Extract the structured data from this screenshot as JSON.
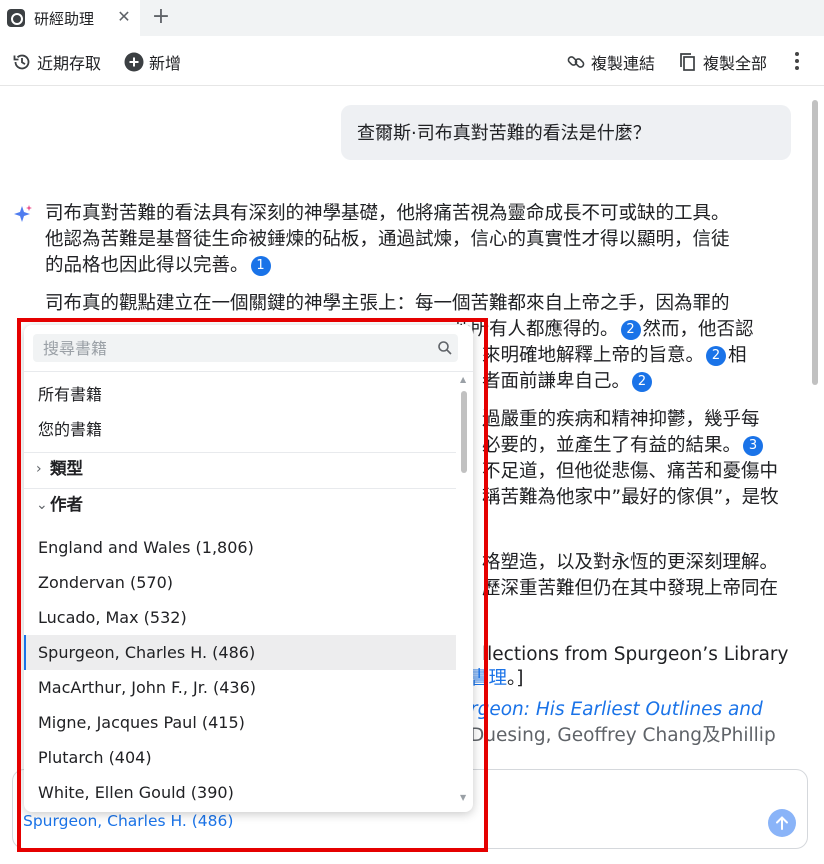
{
  "tab": {
    "title": "研經助理",
    "close_glyph": "✕",
    "new_glyph": "+"
  },
  "toolbar": {
    "recent": "近期存取",
    "new": "新增",
    "copy_link": "複製連結",
    "copy_all": "複製全部"
  },
  "conversation": {
    "question": "查爾斯·司布真對苦難的看法是什麼？",
    "answer_p1": [
      {
        "text": "司布真對苦難的看法具有深刻的神學基礎，他將痛苦視為靈命成長不可或缺的工具。"
      },
      {
        "text": "他認為苦難是基督徒生命被錘煉的砧板，通過試煉，信心的真實性才得以顯明，信徒"
      },
      {
        "text": "的品格也因此得以完善。",
        "cite": "1"
      }
    ],
    "answer_p2_line1": "司布真的觀點建立在一個關鍵的神學主張上：每一個苦難都來自上帝之手，因為罪的",
    "visible_fragments": {
      "l2": "苦所有人都應得的。",
      "l2_cite": "2",
      "l2_tail": "然而，他否認",
      "l3": "來明確地解釋上帝的旨意。",
      "l3_cite": "2",
      "l3_tail": "相",
      "l4": "者面前謙卑自己。",
      "l4_cite": "2",
      "l5": "過嚴重的疾病和精神抑鬱，幾乎每",
      "l6": "必要的，並產生了有益的結果。",
      "l6_cite": "3",
      "l7": "不足道，但他從悲傷、痛苦和憂傷中",
      "l8": "稱苦難為他家中”最好的傢俱”，是牧",
      "l9": "格塑造，以及對永恆的更深刻理解。",
      "l10": "歷深重苦難但仍在其中發現上帝同在",
      "ref1": "llections from Spurgeon’s Library",
      "ref1b_link": "書理",
      "ref1b_tail": "。]",
      "ref2": "rgeon: His Earliest Outlines and",
      "ref3": "Duesing, Geoffrey Chang及Phillip"
    }
  },
  "input": {
    "chip": "Spurgeon, Charles H. (486)"
  },
  "dropdown": {
    "search_placeholder": "搜尋書籍",
    "all_books": "所有書籍",
    "your_books": "您的書籍",
    "group_type": "類型",
    "group_author": "作者",
    "authors": [
      "England and Wales (1,806)",
      "Zondervan (570)",
      "Lucado, Max (532)",
      "Spurgeon, Charles H. (486)",
      "MacArthur, John F., Jr. (436)",
      "Migne, Jacques Paul (415)",
      "Plutarch (404)",
      "White, Ellen Gould (390)"
    ],
    "selected_index": 3
  },
  "colors": {
    "accent": "#1a73e8",
    "highlight": "#e50000"
  },
  "icons": [
    "app-logo-icon",
    "close-icon",
    "plus-icon",
    "history-icon",
    "add-circle-icon",
    "link-icon",
    "copy-icon",
    "more-vert-icon",
    "sparkle-icon",
    "search-icon",
    "chevron-right-icon",
    "chevron-down-icon",
    "send-arrow-icon"
  ]
}
